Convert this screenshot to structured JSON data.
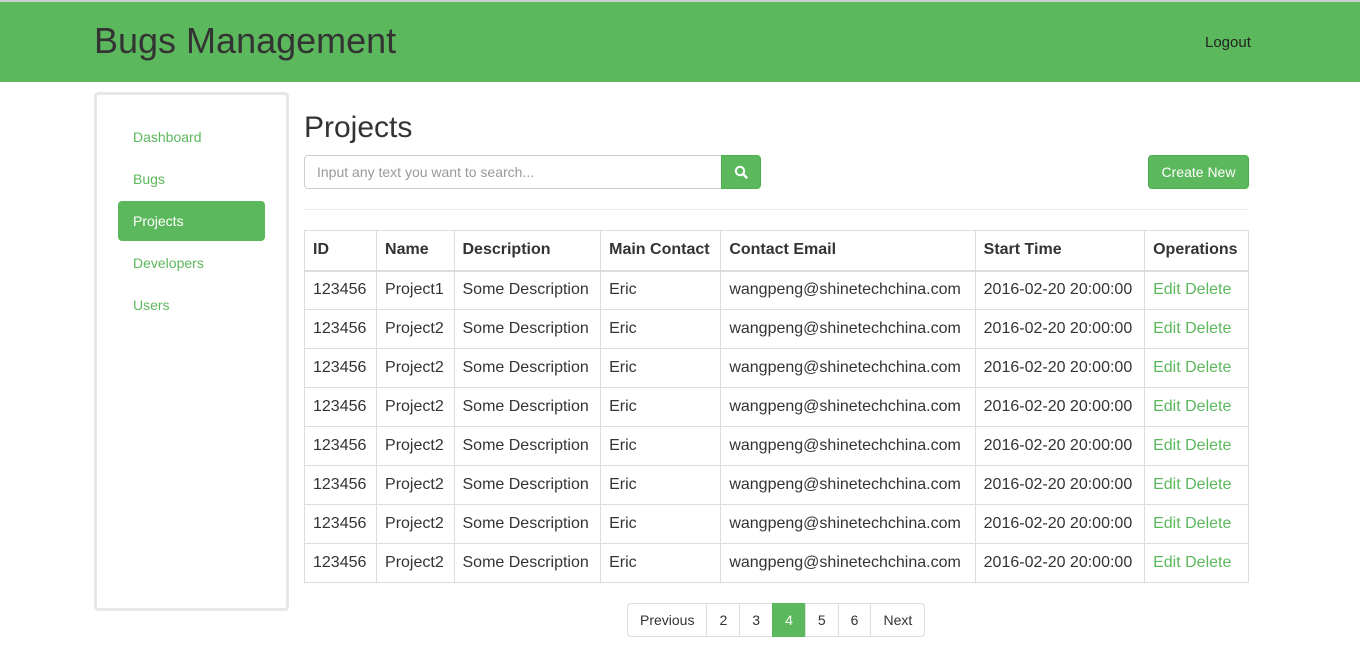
{
  "header": {
    "title": "Bugs Management",
    "logout": "Logout"
  },
  "sidebar": {
    "items": [
      {
        "label": "Dashboard"
      },
      {
        "label": "Bugs"
      },
      {
        "label": "Projects",
        "active": true
      },
      {
        "label": "Developers"
      },
      {
        "label": "Users"
      }
    ]
  },
  "main": {
    "title": "Projects",
    "search": {
      "placeholder": "Input any text you want to search...",
      "value": ""
    },
    "create_label": "Create New",
    "table": {
      "columns": [
        "ID",
        "Name",
        "Description",
        "Main Contact",
        "Contact Email",
        "Start Time",
        "Operations"
      ],
      "rows": [
        [
          "123456",
          "Project1",
          "Some Description",
          "Eric",
          "wangpeng@shinetechchina.com",
          "2016-02-20 20:00:00"
        ],
        [
          "123456",
          "Project2",
          "Some Description",
          "Eric",
          "wangpeng@shinetechchina.com",
          "2016-02-20 20:00:00"
        ],
        [
          "123456",
          "Project2",
          "Some Description",
          "Eric",
          "wangpeng@shinetechchina.com",
          "2016-02-20 20:00:00"
        ],
        [
          "123456",
          "Project2",
          "Some Description",
          "Eric",
          "wangpeng@shinetechchina.com",
          "2016-02-20 20:00:00"
        ],
        [
          "123456",
          "Project2",
          "Some Description",
          "Eric",
          "wangpeng@shinetechchina.com",
          "2016-02-20 20:00:00"
        ],
        [
          "123456",
          "Project2",
          "Some Description",
          "Eric",
          "wangpeng@shinetechchina.com",
          "2016-02-20 20:00:00"
        ],
        [
          "123456",
          "Project2",
          "Some Description",
          "Eric",
          "wangpeng@shinetechchina.com",
          "2016-02-20 20:00:00"
        ],
        [
          "123456",
          "Project2",
          "Some Description",
          "Eric",
          "wangpeng@shinetechchina.com",
          "2016-02-20 20:00:00"
        ]
      ],
      "edit_label": "Edit",
      "delete_label": "Delete"
    },
    "pagination": {
      "items": [
        "Previous",
        "2",
        "3",
        "4",
        "5",
        "6",
        "Next"
      ],
      "active": "4"
    }
  },
  "colors": {
    "accent": "#5cb85c"
  }
}
